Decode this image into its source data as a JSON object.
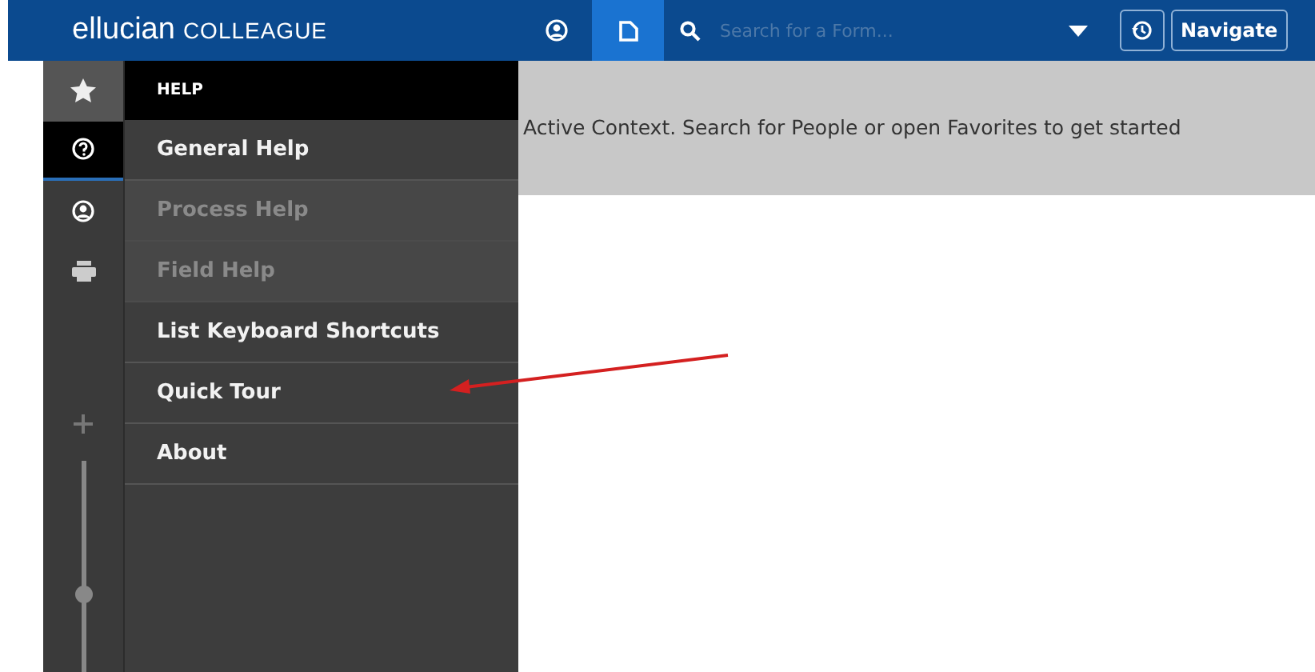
{
  "header": {
    "brand": "ellucian",
    "product": "COLLEAGUE",
    "tabs": [
      {
        "kind": "person",
        "selected": false
      },
      {
        "kind": "form",
        "selected": true
      }
    ],
    "search": {
      "placeholder": "Search for a Form..."
    },
    "navigate_button": "Navigate"
  },
  "sidebar": {
    "items": [
      {
        "kind": "star",
        "selected": false
      },
      {
        "kind": "help",
        "selected": true
      },
      {
        "kind": "person",
        "selected": false
      },
      {
        "kind": "print",
        "selected": false
      }
    ],
    "zoom": {
      "level": 0.36
    }
  },
  "help_menu": {
    "title": "HELP",
    "items": [
      {
        "label": "General Help",
        "disabled": false
      },
      {
        "label": "Process Help",
        "disabled": true
      },
      {
        "label": "Field Help",
        "disabled": true
      },
      {
        "label": "List Keyboard Shortcuts",
        "disabled": false
      },
      {
        "label": "Quick Tour",
        "disabled": false
      },
      {
        "label": "About",
        "disabled": false
      }
    ]
  },
  "banner": {
    "text": "Active Context. Search for People or open Favorites to get started"
  }
}
